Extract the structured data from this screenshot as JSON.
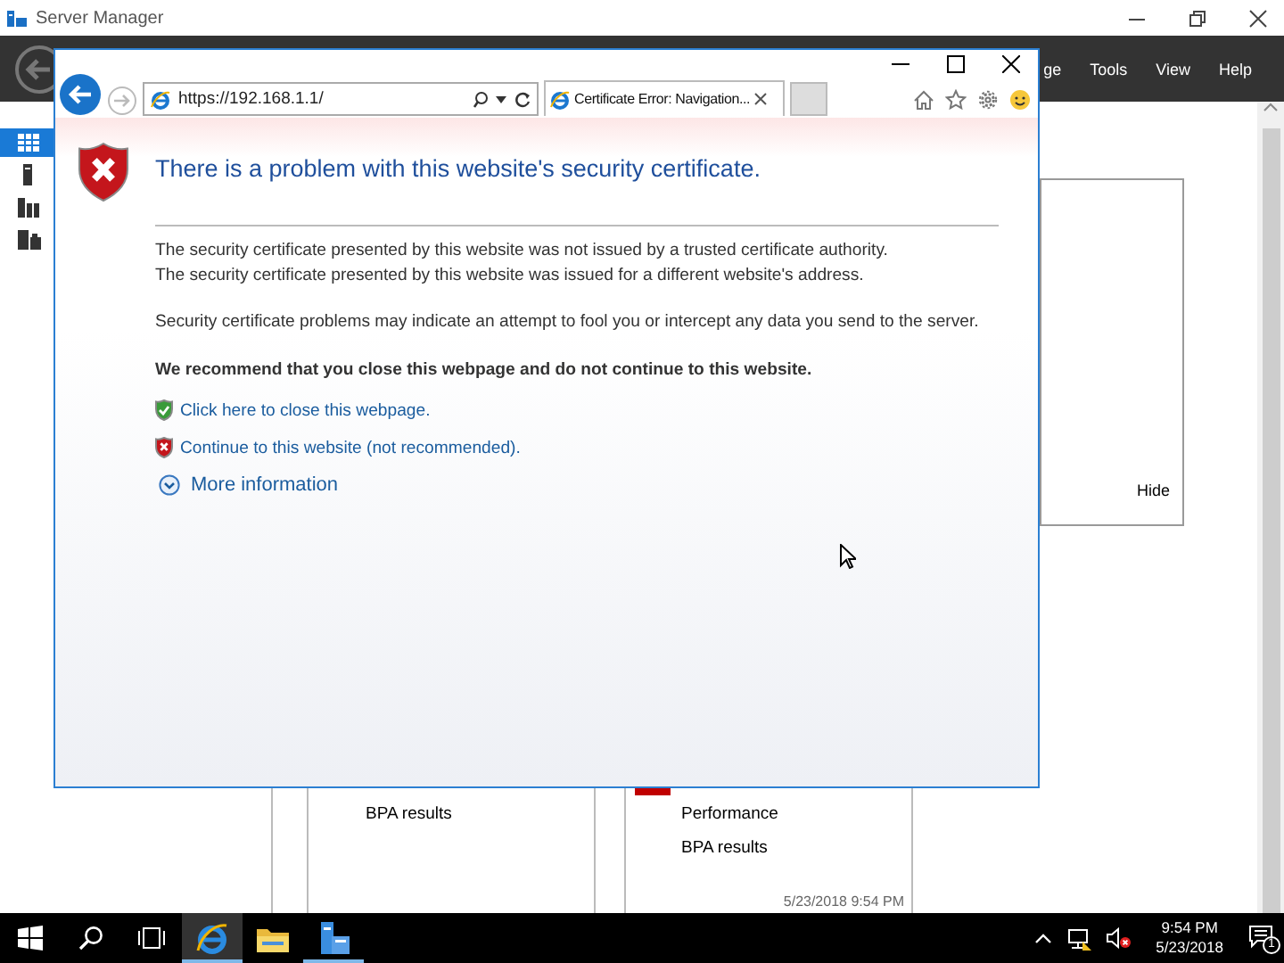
{
  "server_manager": {
    "title": "Server Manager",
    "menu": [
      "ge",
      "Tools",
      "View",
      "Help"
    ],
    "sidebar": [
      {
        "selected": true
      },
      {
        "selected": false
      },
      {
        "selected": false
      },
      {
        "selected": false
      }
    ],
    "panel": {
      "hide_label": "Hide"
    },
    "tiles": [
      {
        "items": [
          "BPA results"
        ]
      },
      {
        "items": [
          "Performance",
          "BPA results"
        ],
        "color": "#c00000"
      }
    ],
    "timestamp": "5/23/2018 9:54 PM"
  },
  "browser": {
    "address": "https://192.168.1.1/",
    "tab_title": "Certificate Error: Navigation...",
    "page": {
      "title": "There is a problem with this website's security certificate.",
      "paragraphs": [
        [
          "The security certificate presented by this website was not issued by a trusted certificate authority.",
          "The security certificate presented by this website was issued for a different website's address."
        ],
        [
          "Security certificate problems may indicate an attempt to fool you or intercept any data you send to the server."
        ]
      ],
      "recommendation": "We recommend that you close this webpage and do not continue to this website.",
      "links": [
        {
          "kind": "safe",
          "text": "Click here to close this webpage."
        },
        {
          "kind": "unsafe",
          "text": "Continue to this website (not recommended)."
        }
      ],
      "more_info": "More information"
    }
  },
  "taskbar": {
    "apps": [
      {
        "kind": "start"
      },
      {
        "kind": "search"
      },
      {
        "kind": "task-view"
      },
      {
        "kind": "browser",
        "running": true,
        "active": true
      },
      {
        "kind": "explorer",
        "running": false,
        "active": false
      },
      {
        "kind": "server-manager",
        "running": true,
        "active": false
      }
    ],
    "clock": {
      "time": "9:54 PM",
      "date": "5/23/2018"
    },
    "notifications": "1"
  }
}
